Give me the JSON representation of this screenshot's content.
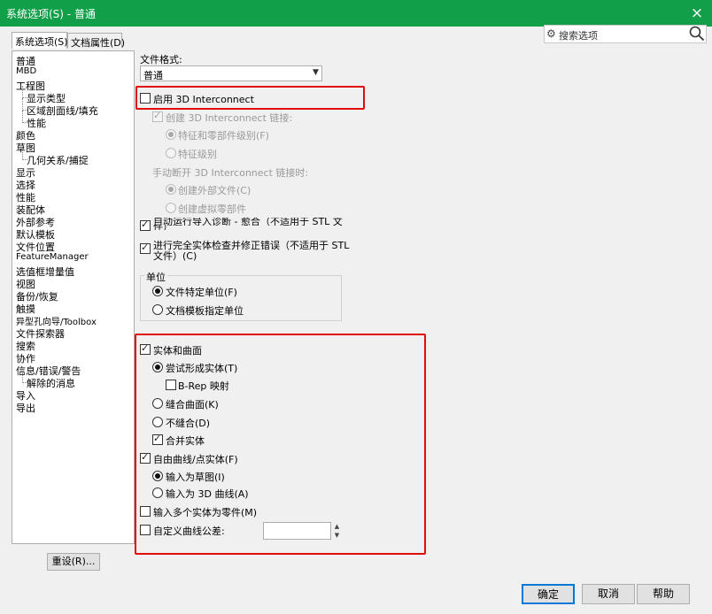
{
  "window": {
    "title": "系统选项(S) - 普通",
    "close": "×"
  },
  "tabs": [
    {
      "label": "系统选项(S)"
    },
    {
      "label": "文档属性(D)"
    }
  ],
  "search": {
    "placeholder": "搜索选项"
  },
  "nav": [
    "普通",
    "MBD",
    "工程图",
    "显示类型",
    "区域剖面线/填充",
    "性能",
    "颜色",
    "草图",
    "几何关系/捕捉",
    "显示",
    "选择",
    "性能",
    "装配体",
    "外部参考",
    "默认模板",
    "文件位置",
    "FeatureManager",
    "选值框增量值",
    "视图",
    "备份/恢复",
    "触摸",
    "异型孔向导/Toolbox",
    "文件探索器",
    "搜索",
    "协作",
    "信息/错误/警告",
    "解除的消息",
    "导入",
    "导出"
  ],
  "reset": "重设(R)...",
  "general": {
    "file_format_label": "文件格式:",
    "file_format_value": "普通",
    "enable_3di": "启用 3D Interconnect",
    "create_link": "创建 3D Interconnect 链接:",
    "feature_part_level": "特征和零部件级别(F)",
    "feature_level": "特征级别",
    "break_link_label": "手动断开 3D Interconnect 链接时:",
    "create_external_file": "创建外部文件(C)",
    "create_virtual_part": "创建虚拟零部件",
    "auto_diag": "自动运行导入诊断 - 愈合（不适用于 STL 文",
    "auto_diag_2": "件）",
    "full_check": "进行完全实体检查并修正错误（不适用于 STL",
    "full_check_2": "文件）(C)"
  },
  "units": {
    "title": "单位",
    "file_specific": "文件特定单位(F)",
    "template_specific": "文档模板指定单位"
  },
  "solids": {
    "solid_surface": "实体和曲面",
    "try_form_solid": "尝试形成实体(T)",
    "brep_map": "B-Rep 映射",
    "knit_surface": "缝合曲面(K)",
    "no_knit": "不缝合(D)",
    "merge_solid": "合并实体",
    "free_curve": "自由曲线/点实体(F)",
    "import_sketch": "输入为草图(I)",
    "import_3d_curve": "输入为 3D 曲线(A)",
    "multi_body_part": "输入多个实体为零件(M)",
    "custom_tolerance": "自定义曲线公差:"
  },
  "buttons": {
    "ok": "确定",
    "cancel": "取消",
    "help": "帮助"
  }
}
